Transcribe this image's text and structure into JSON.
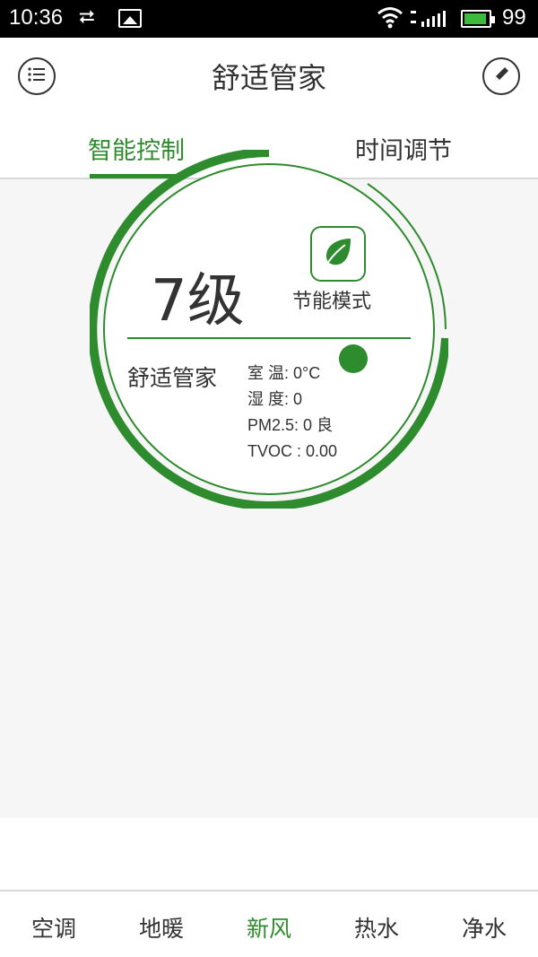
{
  "status_bar": {
    "time": "10:36",
    "battery_level": "99",
    "icons": [
      "usb-icon",
      "image-icon",
      "wifi-icon",
      "signal-icon",
      "battery-icon"
    ]
  },
  "header": {
    "title": "舒适管家",
    "left_icon": "menu-list-icon",
    "right_icon": "edit-pencil-icon"
  },
  "tabs": [
    {
      "label": "智能控制",
      "active": true
    },
    {
      "label": "时间调节",
      "active": false
    }
  ],
  "dial": {
    "level": "7级",
    "eco_mode_label": "节能模式",
    "eco_icon": "leaf-icon",
    "comfort_name": "舒适管家",
    "readings": {
      "room_temp": "室 温: 0°C",
      "humidity": "湿 度: 0",
      "pm25": "PM2.5: 0 良",
      "tvoc": "TVOC : 0.00"
    }
  },
  "bottom_nav": [
    {
      "label": "空调",
      "active": false
    },
    {
      "label": "地暖",
      "active": false
    },
    {
      "label": "新风",
      "active": true
    },
    {
      "label": "热水",
      "active": false
    },
    {
      "label": "净水",
      "active": false
    }
  ],
  "colors": {
    "accent": "#2e8b2e",
    "background": "#f6f6f6",
    "text": "#333333",
    "status_bar": "#000000"
  }
}
